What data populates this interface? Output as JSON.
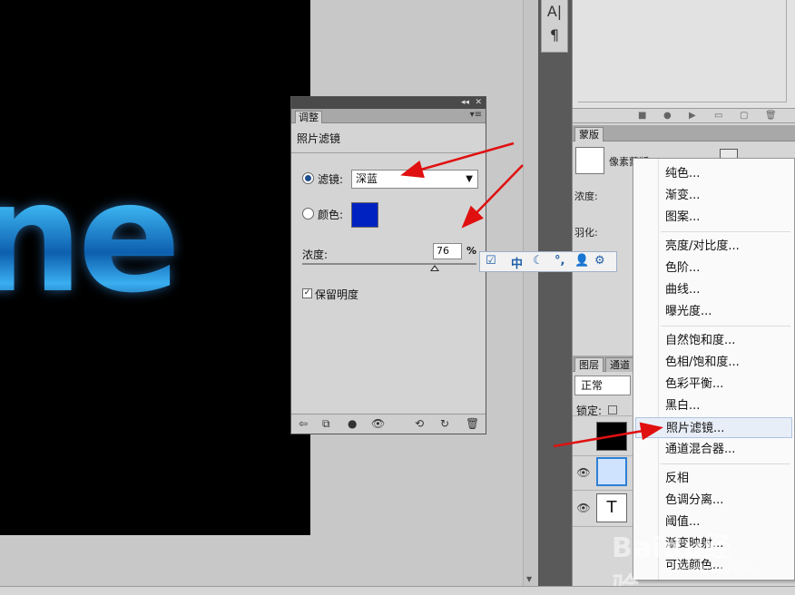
{
  "canvas": {
    "text": "ne"
  },
  "toolbox": {
    "char_icon": "A|",
    "para_icon": "¶"
  },
  "masks_panel": {
    "tab_label": "蒙版",
    "mask_label": "像素蒙版",
    "density_label": "浓度:",
    "feather_label": "羽化:"
  },
  "layers_panel": {
    "tab_layers": "图层",
    "tab_channels": "通道",
    "blend_mode": "正常",
    "lock_label": "锁定:",
    "text_layer_glyph": "T"
  },
  "adjustments": {
    "tab_label": "调整",
    "header": "照片滤镜",
    "filter_label": "滤镜:",
    "filter_value": "深蓝",
    "color_label": "颜色:",
    "color_value": "#0022c0",
    "density_label": "浓度:",
    "density_value": "76",
    "density_unit": "%",
    "density_fraction": 0.76,
    "preserve_luminosity_label": "保留明度",
    "preserve_luminosity_checked": true
  },
  "ime_toolbar": {
    "mode": "中"
  },
  "context_menu": {
    "items": [
      "纯色...",
      "渐变...",
      "图案...",
      "亮度/对比度...",
      "色阶...",
      "曲线...",
      "曝光度...",
      "自然饱和度...",
      "色相/饱和度...",
      "色彩平衡...",
      "黑白...",
      "照片滤镜...",
      "通道混合器...",
      "反相",
      "色调分离...",
      "阈值...",
      "渐变映射...",
      "可选颜色..."
    ],
    "highlighted_index": 11
  },
  "watermark": {
    "brand": "Baidu经验",
    "url": "jingyan.baidu.com"
  },
  "colors": {
    "arrow": "#e01010",
    "highlight": "#e8eef7",
    "canvas_bg": "#000000",
    "accent_blue": "#1e4f8c"
  }
}
